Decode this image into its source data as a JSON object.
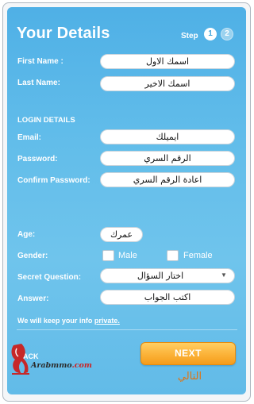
{
  "form": {
    "title": "Your Details",
    "step_label": "Step",
    "steps": [
      "1",
      "2"
    ],
    "current_step": 1
  },
  "fields": {
    "first_name": {
      "label": "First Name :",
      "value": "اسمك الاول"
    },
    "last_name": {
      "label": "Last Name:",
      "value": "اسمك الاخير"
    },
    "login_section": "LOGIN DETAILS",
    "email": {
      "label": "Email:",
      "value": "ايميلك"
    },
    "password": {
      "label": "Password:",
      "value": "الرقم السري"
    },
    "confirm_password": {
      "label": "Confirm Password:",
      "value": "اعادة الرقم السري"
    },
    "age": {
      "label": "Age:",
      "value": "عمرك"
    },
    "gender": {
      "label": "Gender:",
      "options": [
        "Male",
        "Female"
      ]
    },
    "secret_question": {
      "label": "Secret Question:",
      "value": "اختار السؤال"
    },
    "answer": {
      "label": "Answer:",
      "value": "اكتب الجواب"
    }
  },
  "privacy": {
    "text": "We will keep your info",
    "link": "private."
  },
  "nav": {
    "back_label": "ACK",
    "next_label": "NEXT",
    "next_arabic": "التالي"
  },
  "watermark": {
    "name": "Arabmmo",
    "suffix": ".com"
  },
  "colors": {
    "panel_blue": "#5cb8e8",
    "button_orange": "#fbb238",
    "arabic_orange": "#e07412"
  }
}
